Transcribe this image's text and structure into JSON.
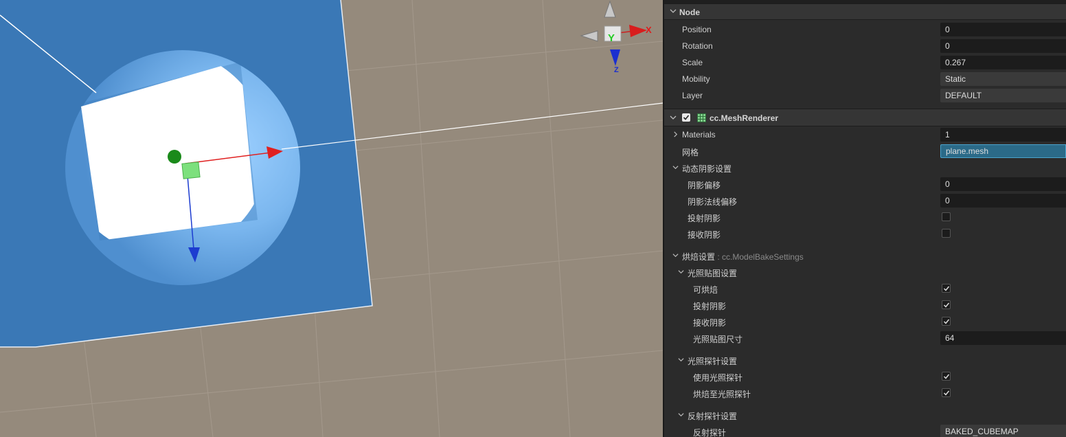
{
  "gizmo": {
    "x_label": "X",
    "y_label": "Y",
    "z_label": "Z"
  },
  "inspector": {
    "node": {
      "header": "Node",
      "rows": [
        {
          "label": "Position",
          "value": "0"
        },
        {
          "label": "Rotation",
          "value": "0"
        },
        {
          "label": "Scale",
          "value": "0.267"
        },
        {
          "label": "Mobility",
          "value": "Static"
        },
        {
          "label": "Layer",
          "value": "DEFAULT"
        }
      ]
    },
    "mesh_renderer": {
      "header": "cc.MeshRenderer",
      "enabled": true,
      "materials": {
        "label": "Materials",
        "value": "1"
      },
      "mesh": {
        "label": "网格",
        "value": "plane.mesh"
      },
      "dynamic_shadow": {
        "label": "动态阴影设置",
        "shadow_bias": {
          "label": "阴影偏移",
          "value": "0"
        },
        "shadow_normal_bias": {
          "label": "阴影法线偏移",
          "value": "0"
        },
        "cast_shadow": {
          "label": "投射阴影",
          "checked": false
        },
        "receive_shadow": {
          "label": "接收阴影",
          "checked": false
        }
      },
      "bake": {
        "label": "烘焙设置",
        "type_sep": " : ",
        "type": "cc.ModelBakeSettings",
        "lightmap": {
          "label": "光照贴图设置",
          "bakeable": {
            "label": "可烘焙",
            "checked": true
          },
          "cast_shadow": {
            "label": "投射阴影",
            "checked": true
          },
          "receive_shadow": {
            "label": "接收阴影",
            "checked": true
          },
          "lightmap_size": {
            "label": "光照贴图尺寸",
            "value": "64"
          }
        },
        "light_probe": {
          "label": "光照探针设置",
          "use_probe": {
            "label": "使用光照探针",
            "checked": true
          },
          "bake_to_probe": {
            "label": "烘焙至光照探针",
            "checked": true
          }
        },
        "reflection_probe": {
          "label": "反射探针设置",
          "probe": {
            "label": "反射探针",
            "value": "BAKED_CUBEMAP"
          }
        }
      }
    }
  }
}
